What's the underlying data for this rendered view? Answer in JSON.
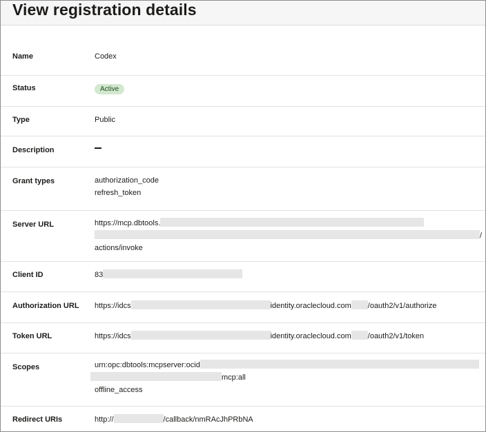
{
  "page": {
    "title": "View registration details"
  },
  "fields": {
    "name": {
      "label": "Name",
      "value": "Codex"
    },
    "status": {
      "label": "Status",
      "value": "Active"
    },
    "type": {
      "label": "Type",
      "value": "Public"
    },
    "description": {
      "label": "Description",
      "value": ""
    },
    "grant_types": {
      "label": "Grant types",
      "values": [
        "authorization_code",
        "refresh_token"
      ]
    },
    "server_url": {
      "label": "Server URL",
      "prefix": "https://mcp.dbtools.",
      "suffix_char": "/",
      "tail": "actions/invoke"
    },
    "client_id": {
      "label": "Client ID",
      "prefix": "83"
    },
    "authorization_url": {
      "label": "Authorization URL",
      "prefix": "https://idcs",
      "middle": "identity.oraclecloud.com",
      "suffix": "/oauth2/v1/authorize"
    },
    "token_url": {
      "label": "Token URL",
      "prefix": "https://idcs",
      "middle": "identity.oraclecloud.com",
      "suffix": "/oauth2/v1/token"
    },
    "scopes": {
      "label": "Scopes",
      "line1": "urn:opc:dbtools:mcpserver:ocid",
      "line2_tail": "mcp:all",
      "line3": "offline_access"
    },
    "redirect_uris": {
      "label": "Redirect URIs",
      "prefix": "http://",
      "middle": "/callback/",
      "tail": "nmRAcJhPRbNA"
    }
  },
  "colors": {
    "badge_bg": "#d2e8cf",
    "redaction": "#e6e6e6",
    "header_bg": "#f6f6f6"
  }
}
